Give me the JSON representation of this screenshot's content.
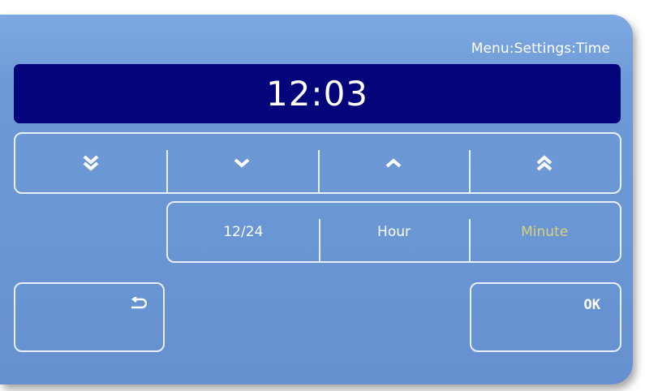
{
  "header": {
    "breadcrumb": "Menu:Settings:Time"
  },
  "display": {
    "time": "12:03"
  },
  "arrows": {
    "items": [
      {
        "name": "fast-down",
        "icon": "double-chevron-down-icon"
      },
      {
        "name": "down",
        "icon": "chevron-down-icon"
      },
      {
        "name": "up",
        "icon": "chevron-up-icon"
      },
      {
        "name": "fast-up",
        "icon": "double-chevron-up-icon"
      }
    ]
  },
  "modes": {
    "items": [
      "12/24",
      "Hour",
      "Minute"
    ],
    "selected": "Minute",
    "selected_color": "#d8d27a"
  },
  "buttons": {
    "back_icon": "return-arrow-icon",
    "ok_label": "OK"
  },
  "colors": {
    "panel": "#6f9cd9",
    "display_background": "#03037a",
    "text": "#ffffff",
    "border": "#e8f0fb"
  }
}
